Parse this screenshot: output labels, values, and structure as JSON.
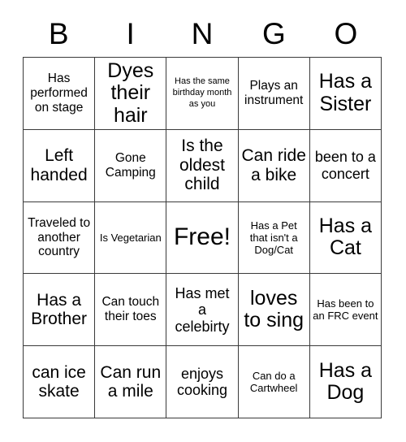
{
  "card": {
    "title": "BINGO",
    "header_letters": [
      "B",
      "I",
      "N",
      "G",
      "O"
    ],
    "grid_size": "5x5",
    "free_space_label": "Free!",
    "colors": {
      "background": "#ffffff",
      "text": "#000000",
      "grid_line": "#3a3a3a"
    },
    "rows": [
      [
        {
          "text": "Has performed on stage",
          "size": "md"
        },
        {
          "text": "Dyes their hair",
          "size": "xxl"
        },
        {
          "text": "Has the same birthday month as you",
          "size": "xs"
        },
        {
          "text": "Plays an instrument",
          "size": "md"
        },
        {
          "text": "Has a Sister",
          "size": "xxl"
        }
      ],
      [
        {
          "text": "Left handed",
          "size": "xl"
        },
        {
          "text": "Gone Camping",
          "size": "md"
        },
        {
          "text": "Is the oldest child",
          "size": "xl"
        },
        {
          "text": "Can ride a bike",
          "size": "xl"
        },
        {
          "text": "been to a concert",
          "size": "lg"
        }
      ],
      [
        {
          "text": "Traveled to another country",
          "size": "md"
        },
        {
          "text": "Is Vegetarian",
          "size": "sm"
        },
        {
          "text": "Free!",
          "size": "free"
        },
        {
          "text": "Has a Pet that isn't a Dog/Cat",
          "size": "sm"
        },
        {
          "text": "Has a Cat",
          "size": "xxl"
        }
      ],
      [
        {
          "text": "Has a Brother",
          "size": "xl"
        },
        {
          "text": "Can touch their toes",
          "size": "md"
        },
        {
          "text": "Has met a celebirty",
          "size": "lg"
        },
        {
          "text": "loves to sing",
          "size": "xxl"
        },
        {
          "text": "Has been to an FRC event",
          "size": "sm"
        }
      ],
      [
        {
          "text": "can ice skate",
          "size": "xl"
        },
        {
          "text": "Can run a mile",
          "size": "xl"
        },
        {
          "text": "enjoys cooking",
          "size": "lg"
        },
        {
          "text": "Can do a Cartwheel",
          "size": "sm"
        },
        {
          "text": "Has a Dog",
          "size": "xxl"
        }
      ]
    ]
  }
}
